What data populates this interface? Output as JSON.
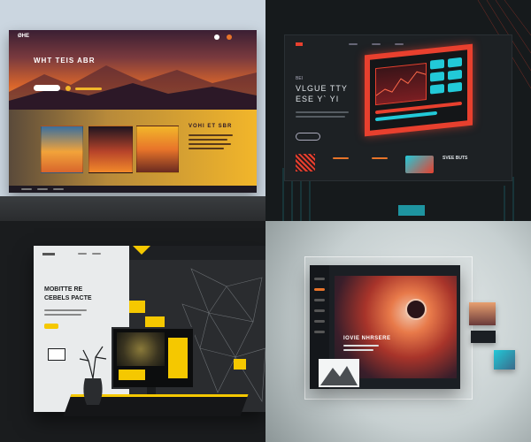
{
  "panel1": {
    "logo": "ØHE",
    "hero_title": "WHT TEIS ABR",
    "cta_label": "",
    "section_title": "VOHI ET SBR",
    "thumb_captions": [
      "",
      "",
      ""
    ]
  },
  "panel2": {
    "hero_title_line1": "BEI",
    "hero_title_line2": "VLGUE TTY",
    "hero_title_line3": "ESE Y` YI",
    "cta_label": "",
    "card_titles": [
      "",
      "",
      ""
    ],
    "side_title": "SVEE BUTS"
  },
  "panel3": {
    "title_line1": "MOBITTE RE",
    "title_line2": "CEBELS PACTE",
    "cta_label": "",
    "cards": [
      "",
      ""
    ]
  },
  "panel4": {
    "hero_title": "IOVIE NHRSERE",
    "nav_items": [
      "",
      "",
      "",
      "",
      "",
      ""
    ]
  },
  "colors": {
    "sunset_orange": "#e8742a",
    "sunset_dark": "#2c1827",
    "gold": "#f2b62a",
    "neon_cyan": "#22c9d8",
    "neon_red": "#e8402e",
    "accent_yellow": "#f5c800",
    "dark_slate": "#191c20"
  }
}
